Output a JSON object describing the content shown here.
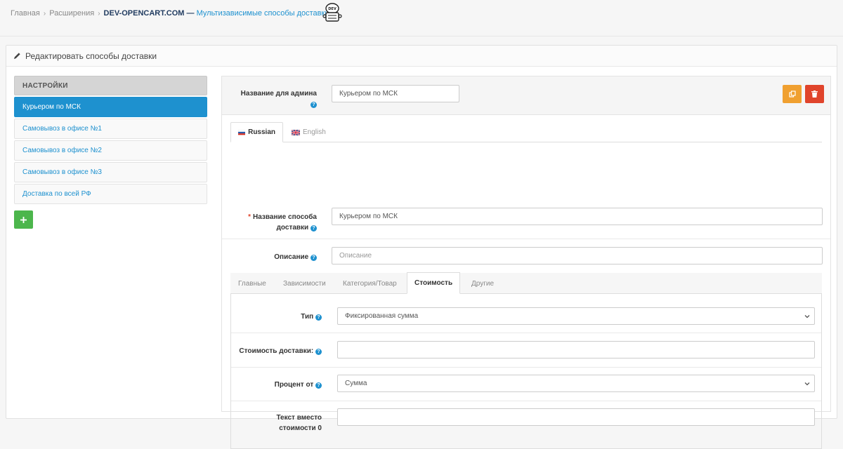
{
  "breadcrumb": {
    "home": "Главная",
    "extensions": "Расширения",
    "brand": "DEV-OPENCART.COM —",
    "module": "Мультизависимые способы доставки",
    "logo_text": "DEV"
  },
  "panel": {
    "title": "Редактировать способы доставки"
  },
  "sidebar": {
    "header": "НАСТРОЙКИ",
    "items": [
      {
        "label": "Курьером по МСК",
        "active": true
      },
      {
        "label": "Самовывоз в офисе №1"
      },
      {
        "label": "Самовывоз в офисе №2"
      },
      {
        "label": "Самовывоз в офисе №3"
      },
      {
        "label": "Доставка по всей РФ"
      }
    ]
  },
  "form": {
    "admin_name_label": "Название для админа",
    "admin_name_value": "Курьером по МСК",
    "languages": [
      "Russian",
      "English"
    ],
    "shipping_name_label_1": "Название способа",
    "shipping_name_label_2": "доставки",
    "shipping_name_value": "Курьером по МСК",
    "description_label": "Описание",
    "description_placeholder": "Описание",
    "tabs": [
      "Главные",
      "Зависимости",
      "Категория/Товар",
      "Стоимость",
      "Другие"
    ],
    "active_tab": "Стоимость",
    "type_label": "Тип",
    "type_value": "Фиксированная сумма",
    "cost_label": "Стоимость доставки:",
    "cost_value": "",
    "percent_label": "Процент от",
    "percent_value": "Сумма",
    "text_zero_label_1": "Текст вместо",
    "text_zero_label_2": "стоимости 0",
    "text_zero_value": ""
  },
  "colors": {
    "primary": "#1e91cf",
    "warning": "#f0a030",
    "danger": "#e0442b",
    "success": "#4cb64c"
  },
  "icons": {
    "copy": "copy-icon",
    "delete": "trash-icon",
    "add": "plus-icon",
    "edit": "pencil-icon",
    "help": "question-icon"
  }
}
